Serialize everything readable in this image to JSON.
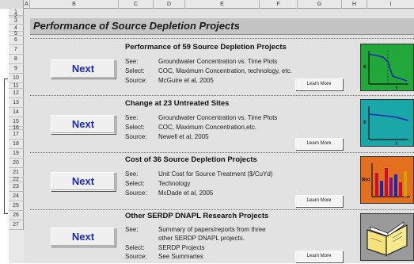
{
  "columns": [
    "A",
    "B",
    "C",
    "D",
    "E",
    "F",
    "G",
    "H",
    "I"
  ],
  "rows": [
    "1",
    "2",
    "3",
    "4",
    "5",
    "6",
    "7",
    "8",
    "9",
    "10",
    "11",
    "12",
    "13",
    "14",
    "15",
    "16",
    "17",
    "18",
    "19",
    "20",
    "21",
    "22",
    "23",
    "24",
    "25",
    "26",
    "27"
  ],
  "title": "Performance of Source Depletion Projects",
  "sections": [
    {
      "next_label": "Next",
      "heading": "Performance of 59 Source Depletion Projects",
      "rows": [
        {
          "label": "See:",
          "value": "Groundwater Concentration vs. Time Plots"
        },
        {
          "label": "Select:",
          "value": "COC, Maximum Concentration, technology, etc."
        },
        {
          "label": "Source:",
          "value": "McGuire et al, 2005"
        }
      ],
      "learn_more": "Learn More",
      "thumb_color": "#22a83a",
      "thumb_icon": "concentration-decline-plot-icon",
      "thumb_axis_y": "c",
      "thumb_axis_x": "t"
    },
    {
      "next_label": "Next",
      "heading": "Change at 23 Untreated Sites",
      "rows": [
        {
          "label": "See:",
          "value": "Groundwater Concentration vs. Time Plots"
        },
        {
          "label": "Select:",
          "value": "COC, Maximum Concentration,etc."
        },
        {
          "label": "Source:",
          "value": "Newell et al, 2005"
        }
      ],
      "learn_more": "Learn More",
      "thumb_color": "#1aa7a7",
      "thumb_icon": "concentration-trend-plot-icon",
      "thumb_axis_y": "c",
      "thumb_axis_x": "t"
    },
    {
      "next_label": "Next",
      "heading": "Cost of 36 Source Depletion Projects",
      "rows": [
        {
          "label": "See:",
          "value": "Unit Cost for Source Treatment ($/CuYd)"
        },
        {
          "label": "Select:",
          "value": "Technology"
        },
        {
          "label": "Source:",
          "value": "McDade et al, 2005"
        }
      ],
      "learn_more": "Learn More",
      "thumb_color": "#e2701e",
      "thumb_icon": "cost-bar-chart-icon",
      "thumb_axis_y": "$/yd",
      "thumb_axis_x": ""
    },
    {
      "next_label": "Next",
      "heading": "Other SERDP DNAPL Research Projects",
      "rows": [
        {
          "label": "See:",
          "value": "Summary of papers/reports from three"
        },
        {
          "label": "",
          "value": "other SERDP DNAPL projects."
        },
        {
          "label": "Select:",
          "value": "SERDP Projects"
        },
        {
          "label": "Source:",
          "value": "See Summaries"
        }
      ],
      "learn_more": "Learn More",
      "thumb_color": "#9a9a9a",
      "thumb_icon": "open-book-icon",
      "thumb_axis_y": "",
      "thumb_axis_x": ""
    }
  ]
}
